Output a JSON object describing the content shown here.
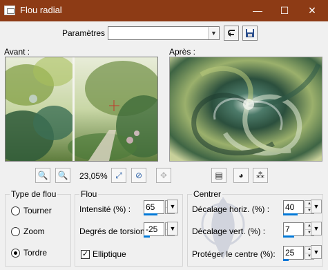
{
  "window": {
    "title": "Flou radial",
    "minimize_glyph": "—",
    "maximize_glyph": "☐",
    "close_glyph": "✕"
  },
  "params": {
    "label": "Paramètres :",
    "preset_value": "",
    "icons": [
      "reset-arrow-icon",
      "save-preset-icon"
    ]
  },
  "previews": {
    "before_label": "Avant :",
    "after_label": "Après :"
  },
  "zoom": {
    "value": "23,05%",
    "icons": [
      "zoom-out-icon",
      "zoom-in-icon",
      "zoom-fit-icon",
      "zoom-actual-icon",
      "pan-icon"
    ]
  },
  "view_buttons": [
    "split-view-icon",
    "proof-icon",
    "random-icon"
  ],
  "blur_type": {
    "title": "Type de flou",
    "options": [
      {
        "label": "Tourner",
        "checked": false
      },
      {
        "label": "Zoom",
        "checked": false
      },
      {
        "label": "Tordre",
        "checked": true
      }
    ]
  },
  "flou": {
    "title": "Flou",
    "intensity_label": "Intensité (%) :",
    "intensity_value": "65",
    "intensity_level": 0.65,
    "torsion_label": "Degrés de torsion :",
    "torsion_value": "-25",
    "torsion_level": 0.3,
    "elliptic_label": "Elliptique",
    "elliptic_checked": true
  },
  "center": {
    "title": "Centrer",
    "h_offset_label": "Décalage horiz. (%) :",
    "h_offset_value": "40",
    "h_offset_level": 0.7,
    "v_offset_label": "Décalage vert. (%) :",
    "v_offset_value": "7",
    "v_offset_level": 0.53,
    "protect_label": "Protéger le centre (%):",
    "protect_value": "25",
    "protect_level": 0.25
  },
  "colors": {
    "titlebar": "#8d3b15",
    "accent": "#0078d7"
  }
}
